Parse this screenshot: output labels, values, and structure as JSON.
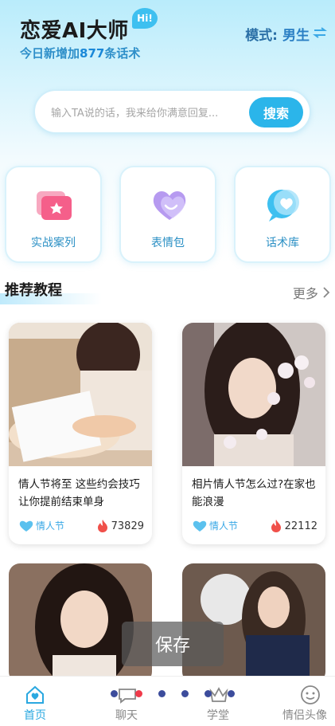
{
  "header": {
    "title": "恋爱AI大师",
    "badge": "Hi!",
    "subtitle_prefix": "今日新增加",
    "subtitle_count": "877",
    "subtitle_suffix": "条话术",
    "mode_label": "模式:",
    "mode_value": "男生",
    "mode_icon": "swap-icon"
  },
  "search": {
    "placeholder": "输入TA说的话，我来给你满意回复...",
    "button_label": "搜索"
  },
  "features": [
    {
      "label": "实战案列",
      "icon": "folder-star-icon"
    },
    {
      "label": "表情包",
      "icon": "heart-smile-icon"
    },
    {
      "label": "话术库",
      "icon": "chat-heart-icon"
    }
  ],
  "section": {
    "title": "推荐教程",
    "more_label": "更多"
  },
  "cards": [
    {
      "title": "情人节将至 这些约会技巧让你提前结束单身",
      "tag": "情人节",
      "count": "73829"
    },
    {
      "title": "相片情人节怎么过?在家也能浪漫",
      "tag": "情人节",
      "count": "22112"
    }
  ],
  "toast": {
    "label": "保存"
  },
  "tabs": [
    {
      "label": "首页",
      "icon": "home-heart-icon",
      "active": true
    },
    {
      "label": "聊天",
      "icon": "chat-bubble-icon",
      "active": false
    },
    {
      "label": "学堂",
      "icon": "crown-icon",
      "active": false
    },
    {
      "label": "情侣头像",
      "icon": "smiley-icon",
      "active": false
    }
  ],
  "colors": {
    "accent": "#2bb5ea",
    "title": "#1b1b1b",
    "tag": "#3aa8e6",
    "hot": "#f0504a"
  }
}
